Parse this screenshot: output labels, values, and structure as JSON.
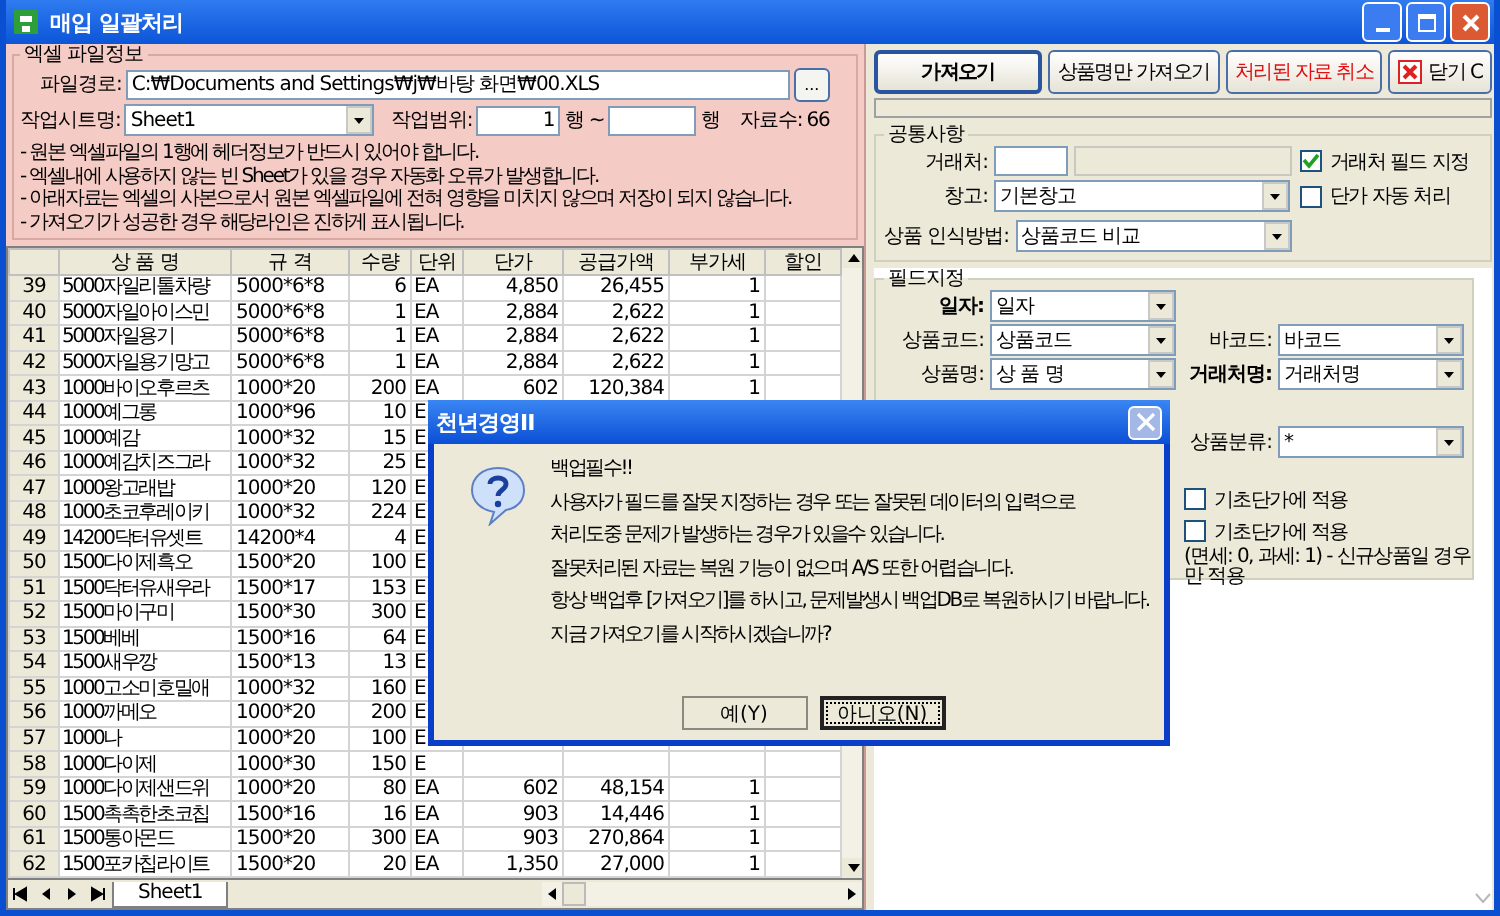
{
  "window": {
    "title": "매입 일괄처리"
  },
  "excel_info": {
    "title": "엑셀 파일정보",
    "file_path_label": "파일경로:",
    "file_path": "C:₩Documents and Settings₩j₩바탕 화면₩00.XLS",
    "browse_button": "...",
    "sheet_label": "작업시트명:",
    "sheet": "Sheet1",
    "range_label": "작업범위:",
    "range_from": "1",
    "range_mid": "행 ~",
    "range_end": "행",
    "count_label": "자료수:",
    "count": "66",
    "notes": [
      "- 원본 엑셀파일의 1행에 헤더정보가 반드시 있어야 합니다.",
      "- 엑셀내에 사용하지 않는 빈 Sheet가 있을 경우 자동화 오류가 발생합니다.",
      "- 아래자료는 엑셀의 사본으로서 원본 엑셀파일에 전혀 영향을 미치지 않으며 저장이 되지 않습니다.",
      "- 가져오기가 성공한 경우 해당라인은 진하게 표시됩니다."
    ]
  },
  "grid": {
    "columns": [
      "상 품 명",
      "규 격",
      "수량",
      "단위",
      "단가",
      "공급가액",
      "부가세",
      "할인"
    ],
    "rows": [
      {
        "num": "39",
        "cells": [
          "5000자일리톨차량",
          "5000*6*8",
          "6",
          "EA",
          "4,850",
          "26,455",
          "1"
        ]
      },
      {
        "num": "40",
        "cells": [
          "5000자일아이스민",
          "5000*6*8",
          "1",
          "EA",
          "2,884",
          "2,622",
          "1"
        ]
      },
      {
        "num": "41",
        "cells": [
          "5000자일용기",
          "5000*6*8",
          "1",
          "EA",
          "2,884",
          "2,622",
          "1"
        ]
      },
      {
        "num": "42",
        "cells": [
          "5000자일용기망고",
          "5000*6*8",
          "1",
          "EA",
          "2,884",
          "2,622",
          "1"
        ]
      },
      {
        "num": "43",
        "cells": [
          "1000바이오후르츠",
          "1000*20",
          "200",
          "EA",
          "602",
          "120,384",
          "1"
        ]
      },
      {
        "num": "44",
        "cells": [
          "1000예그롱",
          "1000*96",
          "10",
          "E"
        ]
      },
      {
        "num": "45",
        "cells": [
          "1000예감",
          "1000*32",
          "15",
          "E"
        ]
      },
      {
        "num": "46",
        "cells": [
          "1000예감치즈그라",
          "1000*32",
          "25",
          "E"
        ]
      },
      {
        "num": "47",
        "cells": [
          "1000왕고래밥",
          "1000*20",
          "120",
          "E"
        ]
      },
      {
        "num": "48",
        "cells": [
          "1000초코후레이키",
          "1000*32",
          "224",
          "E"
        ]
      },
      {
        "num": "49",
        "cells": [
          "14200닥터유셋트",
          "14200*4",
          "4",
          "E"
        ]
      },
      {
        "num": "50",
        "cells": [
          "1500다이제흑오",
          "1500*20",
          "100",
          "E"
        ]
      },
      {
        "num": "51",
        "cells": [
          "1500닥터유새우라",
          "1500*17",
          "153",
          "E"
        ]
      },
      {
        "num": "52",
        "cells": [
          "1500마이구미",
          "1500*30",
          "300",
          "E"
        ]
      },
      {
        "num": "53",
        "cells": [
          "1500베베",
          "1500*16",
          "64",
          "E"
        ]
      },
      {
        "num": "54",
        "cells": [
          "1500새우깡",
          "1500*13",
          "13",
          "E"
        ]
      },
      {
        "num": "55",
        "cells": [
          "1000고소미호밀애",
          "1000*32",
          "160",
          "E"
        ]
      },
      {
        "num": "56",
        "cells": [
          "1000까메오",
          "1000*20",
          "200",
          "E"
        ]
      },
      {
        "num": "57",
        "cells": [
          "1000나",
          "1000*20",
          "100",
          "E"
        ]
      },
      {
        "num": "58",
        "cells": [
          "1000다이제",
          "1000*30",
          "150",
          "E"
        ]
      },
      {
        "num": "59",
        "cells": [
          "1000다이제샌드위",
          "1000*20",
          "80",
          "EA",
          "602",
          "48,154",
          "1"
        ]
      },
      {
        "num": "60",
        "cells": [
          "1500촉촉한초코칩",
          "1500*16",
          "16",
          "EA",
          "903",
          "14,446",
          "1"
        ]
      },
      {
        "num": "61",
        "cells": [
          "1500통아몬드",
          "1500*20",
          "300",
          "EA",
          "903",
          "270,864",
          "1"
        ]
      },
      {
        "num": "62",
        "cells": [
          "1500포카칩라이트",
          "1500*20",
          "20",
          "EA",
          "1,350",
          "27,000",
          "1"
        ]
      }
    ],
    "sheet_tab": "Sheet1"
  },
  "toolbar": [
    {
      "label": "가져오기",
      "kind": "default"
    },
    {
      "label": "상품명만 가져오기",
      "kind": "normal"
    },
    {
      "label": "처리된 자료 취소",
      "kind": "danger"
    },
    {
      "label": "닫기 C",
      "kind": "close"
    }
  ],
  "common": {
    "title": "공통사항",
    "customer_label": "거래처:",
    "warehouse_label": "창고:",
    "warehouse": "기본창고",
    "match_label": "상품 인식방법:",
    "match": "상품코드 비교",
    "checks": [
      {
        "label": "거래처 필드 지정",
        "checked": true
      },
      {
        "label": "단가 자동 처리",
        "checked": false
      }
    ]
  },
  "fields": {
    "title": "필드지정",
    "left": [
      {
        "label": "일자:",
        "value": "일자",
        "emphasis": true
      },
      {
        "label": "상품코드:",
        "value": "상품코드",
        "emphasis": false
      },
      {
        "label": "상품명:",
        "value": "상 품 명",
        "emphasis": false
      }
    ],
    "right": [
      {
        "kind": "select",
        "label": "바코드:",
        "value": "바코드",
        "emphasis": false
      },
      {
        "kind": "select",
        "label": "거래처명:",
        "value": "거래처명",
        "emphasis": true
      },
      {
        "kind": "select",
        "label": "상품분류:",
        "value": "*",
        "emphasis": false
      },
      {
        "kind": "checkbox",
        "label": "기초단가에 적용",
        "checked": false
      },
      {
        "kind": "checkbox",
        "label": "기초단가에 적용",
        "checked": false
      },
      {
        "kind": "note",
        "label": "(면세: 0, 과세: 1) - 신규상품일 경우만 적용"
      }
    ]
  },
  "dialog": {
    "title": "천년경영II",
    "lines": [
      "백업필수!!",
      "사용자가 필드를 잘못 지정하는 경우 또는 잘못된 데이터의 입력으로",
      "처리도중 문제가 발생하는 경우가 있을수 있습니다.",
      "잘못처리된 자료는 복원 기능이 없으며 A/S 또한 어렵습니다.",
      "항상 백업후 [가져오기]를 하시고, 문제발생시 백업DB로 복원하시기 바랍니다.",
      "지금 가져오기를 시작하시겠습니까?"
    ],
    "buttons": [
      {
        "label": "예(Y)",
        "default": false
      },
      {
        "label": "아니오(N)",
        "default": true
      }
    ]
  }
}
